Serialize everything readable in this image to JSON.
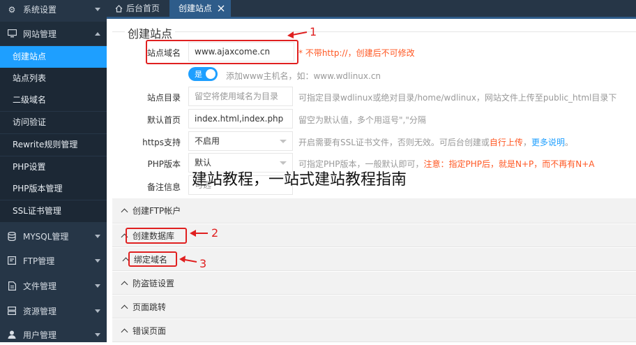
{
  "sidebar": {
    "groups": [
      {
        "label": "系统设置",
        "icon": "gear-icon"
      },
      {
        "label": "网站管理",
        "icon": "monitor-icon"
      },
      {
        "label": "MYSQL管理",
        "icon": "database-icon"
      },
      {
        "label": "FTP管理",
        "icon": "ftp-icon"
      },
      {
        "label": "文件管理",
        "icon": "file-icon"
      },
      {
        "label": "资源管理",
        "icon": "server-icon"
      },
      {
        "label": "用户管理",
        "icon": "user-icon"
      }
    ],
    "sub_items": [
      "创建站点",
      "站点列表",
      "二级域名",
      "访问验证",
      "Rewrite规则管理",
      "PHP设置",
      "PHP版本管理",
      "SSL证书管理"
    ]
  },
  "tabs": {
    "home": {
      "label": "后台首页",
      "icon": "home-icon"
    },
    "current": {
      "label": "创建站点",
      "close_icon": "close-icon"
    }
  },
  "form": {
    "legend": "创建站点",
    "domain": {
      "label": "站点域名",
      "value": "www.ajaxcome.cn",
      "hint": "* 不带http://，创建后不可修改"
    },
    "www_toggle": {
      "label": "是",
      "hint": "添加www主机名，如：www.wdlinux.cn"
    },
    "dir": {
      "label": "站点目录",
      "placeholder": "留空将使用域名为目录",
      "hint": "可指定目录wdlinux或绝对目录/home/wdlinux，网站文件上传至public_html目录下"
    },
    "index": {
      "label": "默认首页",
      "value": "index.html,index.php",
      "hint": "留空为默认值，多个用逗号\",\"分隔"
    },
    "https": {
      "label": "https支持",
      "value": "不启用",
      "hint_pre": "开启需要有SSL证书文件，否则无效。可后台创建或",
      "hint_link1": "自行上传",
      "hint_sep": "，",
      "hint_link2": "更多说明",
      "hint_end": "。"
    },
    "php": {
      "label": "PHP版本",
      "value": "默认",
      "hint_pre": "可指定PHP版本，一般默认即可，",
      "hint_red": "注意：指定PHP后，就是N+P，而不再有N+A"
    },
    "note": {
      "label": "备注信息",
      "placeholder": "可选"
    }
  },
  "accordion": [
    "创建FTP帐户",
    "创建数据库",
    "绑定域名",
    "防盗链设置",
    "页面跳转",
    "错误页面"
  ],
  "annotations": [
    "1",
    "2",
    "3"
  ],
  "watermark": "建站教程，一站式建站教程指南",
  "colors": {
    "sidebar_bg": "#263647",
    "accent": "#1e9fff",
    "annotation": "#e02020",
    "hint_red": "#ff5722"
  }
}
